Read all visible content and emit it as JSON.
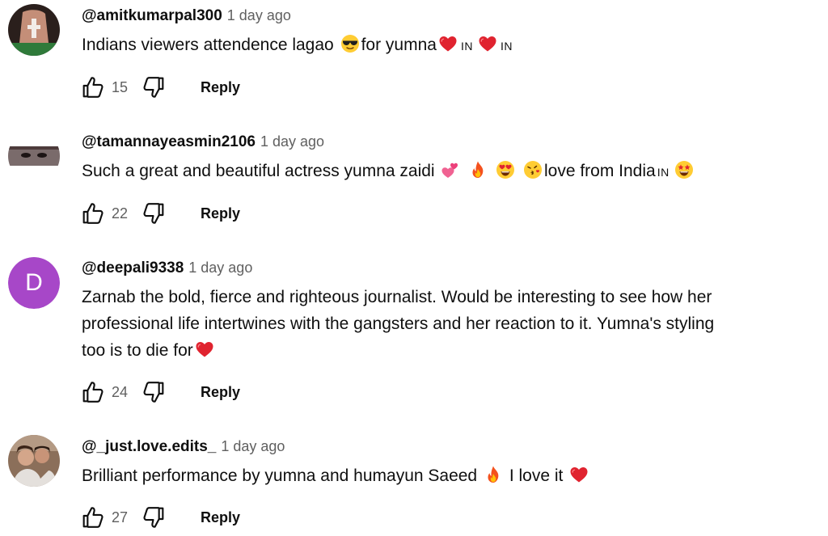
{
  "comments": [
    {
      "author": "@amitkumarpal300",
      "time": "1 day ago",
      "text1": "Indians viewers attendence lagao",
      "text2": "for yumna",
      "flag": "IN",
      "likes": "15",
      "reply": "Reply"
    },
    {
      "author": "@tamannayeasmin2106",
      "time": "1 day ago",
      "text1": "Such a great and beautiful actress yumna zaidi",
      "text2": "love from India",
      "flag": "IN",
      "likes": "22",
      "reply": "Reply"
    },
    {
      "author": "@deepali9338",
      "time": "1 day ago",
      "avatar_letter": "D",
      "avatar_color": "#a747c8",
      "line1": "Zarnab the bold, fierce and righteous journalist. Would be interesting to see how her",
      "line2": "professional life intertwines with the gangsters and her reaction to it. Yumna's styling",
      "line3": "too is to die for",
      "likes": "24",
      "reply": "Reply"
    },
    {
      "author": "@_just.love.edits_",
      "time": "1 day ago",
      "text1": "Brilliant performance by yumna and humayun Saeed",
      "text2": "I love it",
      "likes": "27",
      "reply": "Reply"
    }
  ]
}
